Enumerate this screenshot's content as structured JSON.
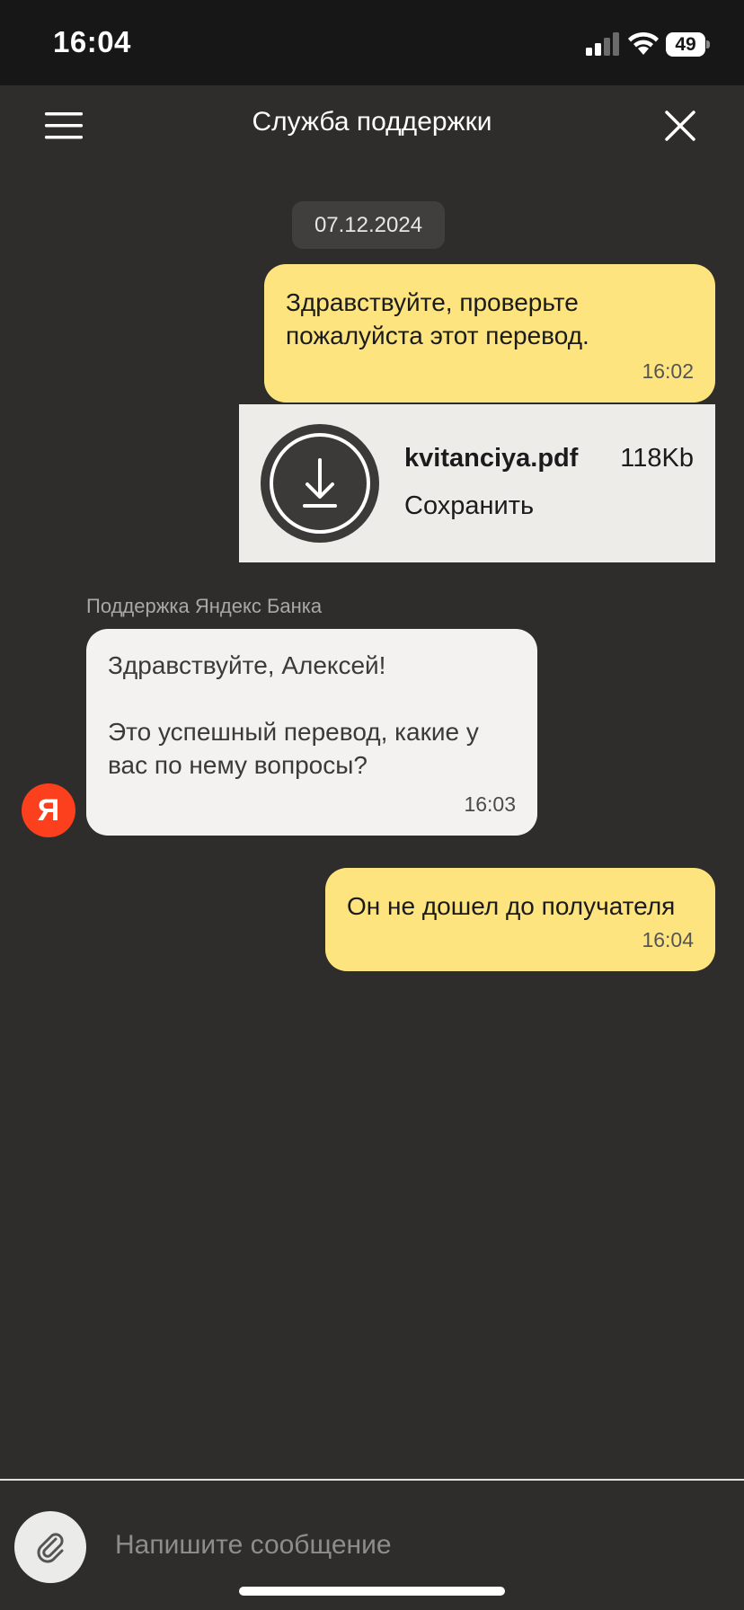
{
  "status_bar": {
    "time": "16:04",
    "battery": "49",
    "icons": [
      "signal-icon",
      "wifi-icon",
      "battery-icon"
    ]
  },
  "header": {
    "title": "Служба поддержки",
    "icons": [
      "menu-icon",
      "close-icon"
    ]
  },
  "chat": {
    "date": "07.12.2024",
    "messages": [
      {
        "direction": "outgoing",
        "text": "Здравствуйте, проверьте пожалуйста этот перевод.",
        "time": "16:02"
      },
      {
        "direction": "outgoing",
        "type": "file",
        "file_name": "kvitanciya.pdf",
        "file_size": "118Kb",
        "action": "Сохранить",
        "icon": "download-icon"
      },
      {
        "direction": "incoming",
        "sender": "Поддержка Яндекс Банка",
        "avatar": "Я",
        "text": "Здравствуйте, Алексей!\n\nЭто успешный перевод, какие у вас по нему вопросы?",
        "time": "16:03"
      },
      {
        "direction": "outgoing",
        "text": "Он не дошел до получателя",
        "time": "16:04"
      }
    ]
  },
  "composer": {
    "placeholder": "Напишите сообщение",
    "value": "",
    "icon": "paperclip-icon"
  },
  "colors": {
    "background": "#2e2d2b",
    "outgoing_bubble": "#fde47f",
    "incoming_bubble": "#f3f2f0",
    "avatar": "#fc3f1d"
  }
}
